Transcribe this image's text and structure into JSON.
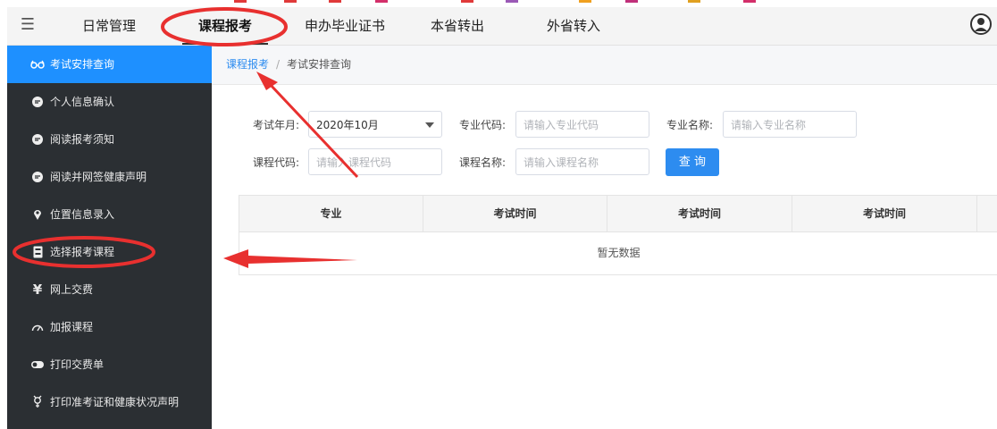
{
  "colors": {
    "sidebar_bg": "#2b2f33",
    "sidebar_active": "#1e90ff",
    "accent": "#2d8cf0",
    "annotation": "#e8302f"
  },
  "topnav": {
    "tabs": [
      {
        "label": "日常管理"
      },
      {
        "label": "课程报考"
      },
      {
        "label": "申办毕业证书"
      },
      {
        "label": "本省转出"
      },
      {
        "label": "外省转入"
      }
    ],
    "active_tab": "课程报考"
  },
  "sidebar": {
    "items": [
      {
        "label": "考试安排查询",
        "icon": "glasses-icon"
      },
      {
        "label": "个人信息确认",
        "icon": "chat-icon"
      },
      {
        "label": "阅读报考须知",
        "icon": "chat-icon"
      },
      {
        "label": "阅读并网签健康声明",
        "icon": "chat-icon"
      },
      {
        "label": "位置信息录入",
        "icon": "map-pin-icon"
      },
      {
        "label": "选择报考课程",
        "icon": "book-icon"
      },
      {
        "label": "网上交费",
        "icon": "yen-icon"
      },
      {
        "label": "加报课程",
        "icon": "gauge-icon"
      },
      {
        "label": "打印交费单",
        "icon": "toggle-icon"
      },
      {
        "label": "打印准考证和健康状况声明",
        "icon": "gender-icon"
      }
    ],
    "active_item": "考试安排查询"
  },
  "breadcrumb": {
    "parent": "课程报考",
    "separator": "/",
    "current": "考试安排查询"
  },
  "form": {
    "exam_month": {
      "label": "考试年月:",
      "value": "2020年10月"
    },
    "major_code": {
      "label": "专业代码:",
      "placeholder": "请输入专业代码"
    },
    "major_name": {
      "label": "专业名称:",
      "placeholder": "请输入专业名称"
    },
    "course_code": {
      "label": "课程代码:",
      "placeholder": "请输入课程代码"
    },
    "course_name": {
      "label": "课程名称:",
      "placeholder": "请输入课程名称"
    },
    "query_button": "查 询"
  },
  "table": {
    "columns": [
      "专业",
      "考试时间",
      "考试时间",
      "考试时间"
    ],
    "empty_text": "暂无数据"
  }
}
